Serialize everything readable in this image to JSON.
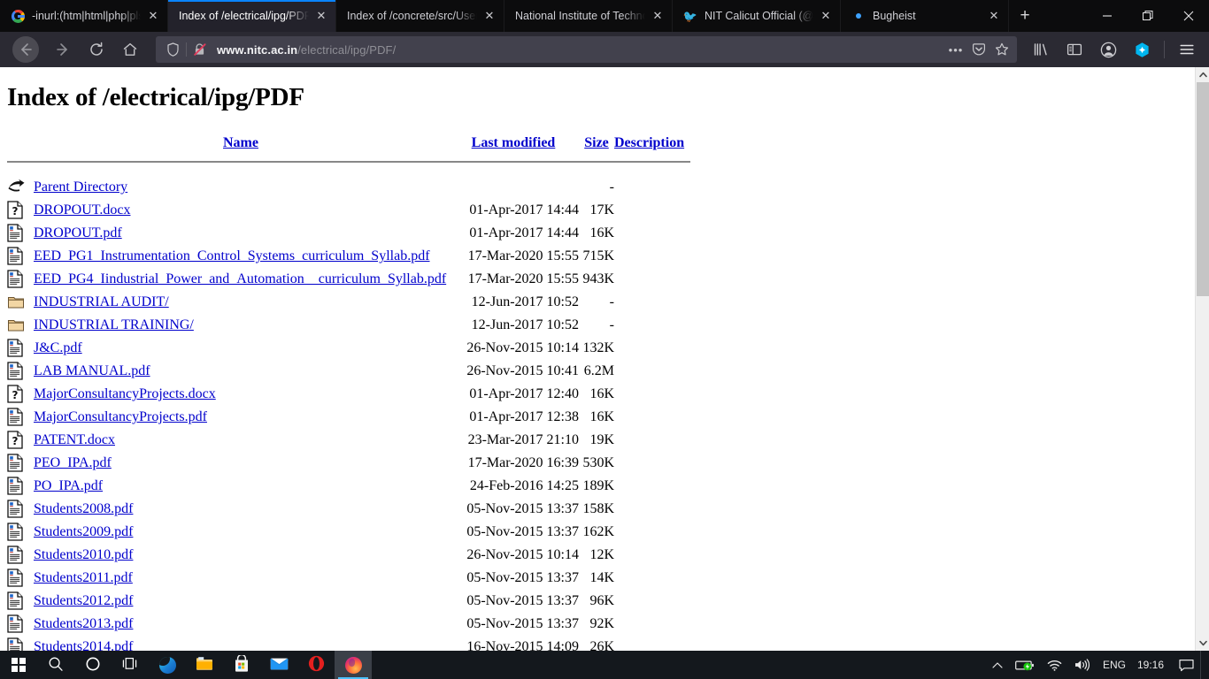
{
  "window": {
    "controls": {
      "minimize": "minimize",
      "restore": "restore",
      "close": "close"
    }
  },
  "tabs": [
    {
      "title": "-inurl:(htm|html|php|pls|t",
      "favicon": "google-icon",
      "active": false,
      "close_label": "✕"
    },
    {
      "title": "Index of /electrical/ipg/PDF",
      "favicon": "document-icon",
      "active": true,
      "close_label": "✕"
    },
    {
      "title": "Index of /concrete/src/User",
      "favicon": "document-icon",
      "active": false,
      "close_label": "✕"
    },
    {
      "title": "National Institute of Technolo",
      "favicon": "document-icon",
      "active": false,
      "close_label": "✕"
    },
    {
      "title": "NIT Calicut Official (@nit",
      "favicon": "twitter-icon",
      "active": false,
      "close_label": "✕"
    },
    {
      "title": "Bugheist",
      "favicon": "dot-icon",
      "active": false,
      "close_label": "✕"
    }
  ],
  "newtab_label": "+",
  "navbar": {
    "back": "back-icon",
    "forward": "forward-icon",
    "reload": "reload-icon",
    "home": "home-icon",
    "shield": "shield-icon",
    "insecure": "insecure-lock-icon",
    "url_domain": "www.nitc.ac.in",
    "url_path": "/electrical/ipg/PDF/",
    "url_full": "www.nitc.ac.in/electrical/ipg/PDF/",
    "more": "•••",
    "pocket": "pocket-icon",
    "bookmark": "star-icon",
    "library": "library-icon",
    "sidebar": "sidebar-icon",
    "account": "account-icon",
    "extension": "extension-icon",
    "menu": "hamburger-menu-icon"
  },
  "page": {
    "title": "Index of /electrical/ipg/PDF",
    "columns": {
      "name": "Name",
      "last_modified": "Last modified",
      "size": "Size",
      "description": "Description"
    },
    "rows": [
      {
        "icon": "parent-directory-icon",
        "name": "Parent Directory",
        "modified": "",
        "size": "-",
        "description": ""
      },
      {
        "icon": "unknown-file-icon",
        "name": "DROPOUT.docx",
        "modified": "01-Apr-2017 14:44",
        "size": "17K",
        "description": ""
      },
      {
        "icon": "text-file-icon",
        "name": "DROPOUT.pdf",
        "modified": "01-Apr-2017 14:44",
        "size": "16K",
        "description": ""
      },
      {
        "icon": "text-file-icon",
        "name": "EED_PG1_Instrumentation_Control_Systems_curriculum_Syllab.pdf",
        "modified": "17-Mar-2020 15:55",
        "size": "715K",
        "description": ""
      },
      {
        "icon": "text-file-icon",
        "name": "EED_PG4_Iindustrial_Power_and_Automation__curriculum_Syllab.pdf",
        "modified": "17-Mar-2020 15:55",
        "size": "943K",
        "description": ""
      },
      {
        "icon": "folder-icon",
        "name": "INDUSTRIAL AUDIT/",
        "modified": "12-Jun-2017 10:52",
        "size": "-",
        "description": ""
      },
      {
        "icon": "folder-icon",
        "name": "INDUSTRIAL TRAINING/",
        "modified": "12-Jun-2017 10:52",
        "size": "-",
        "description": ""
      },
      {
        "icon": "text-file-icon",
        "name": "J&C.pdf",
        "modified": "26-Nov-2015 10:14",
        "size": "132K",
        "description": ""
      },
      {
        "icon": "text-file-icon",
        "name": "LAB MANUAL.pdf",
        "modified": "26-Nov-2015 10:41",
        "size": "6.2M",
        "description": ""
      },
      {
        "icon": "unknown-file-icon",
        "name": "MajorConsultancyProjects.docx",
        "modified": "01-Apr-2017 12:40",
        "size": "16K",
        "description": ""
      },
      {
        "icon": "text-file-icon",
        "name": "MajorConsultancyProjects.pdf",
        "modified": "01-Apr-2017 12:38",
        "size": "16K",
        "description": ""
      },
      {
        "icon": "unknown-file-icon",
        "name": "PATENT.docx",
        "modified": "23-Mar-2017 21:10",
        "size": "19K",
        "description": ""
      },
      {
        "icon": "text-file-icon",
        "name": "PEO_IPA.pdf",
        "modified": "17-Mar-2020 16:39",
        "size": "530K",
        "description": ""
      },
      {
        "icon": "text-file-icon",
        "name": "PO_IPA.pdf",
        "modified": "24-Feb-2016 14:25",
        "size": "189K",
        "description": ""
      },
      {
        "icon": "text-file-icon",
        "name": "Students2008.pdf",
        "modified": "05-Nov-2015 13:37",
        "size": "158K",
        "description": ""
      },
      {
        "icon": "text-file-icon",
        "name": "Students2009.pdf",
        "modified": "05-Nov-2015 13:37",
        "size": "162K",
        "description": ""
      },
      {
        "icon": "text-file-icon",
        "name": "Students2010.pdf",
        "modified": "26-Nov-2015 10:14",
        "size": "12K",
        "description": ""
      },
      {
        "icon": "text-file-icon",
        "name": "Students2011.pdf",
        "modified": "05-Nov-2015 13:37",
        "size": "14K",
        "description": ""
      },
      {
        "icon": "text-file-icon",
        "name": "Students2012.pdf",
        "modified": "05-Nov-2015 13:37",
        "size": "96K",
        "description": ""
      },
      {
        "icon": "text-file-icon",
        "name": "Students2013.pdf",
        "modified": "05-Nov-2015 13:37",
        "size": "92K",
        "description": ""
      },
      {
        "icon": "text-file-icon",
        "name": "Students2014.pdf",
        "modified": "16-Nov-2015 14:09",
        "size": "26K",
        "description": ""
      }
    ]
  },
  "taskbar": {
    "items": [
      {
        "icon": "windows-start-icon",
        "name": "start-button",
        "active": false
      },
      {
        "icon": "search-icon",
        "name": "search-button",
        "active": false
      },
      {
        "icon": "cortana-icon",
        "name": "cortana-button",
        "active": false
      },
      {
        "icon": "task-view-icon",
        "name": "task-view-button",
        "active": false
      },
      {
        "icon": "edge-icon",
        "name": "edge-button",
        "active": false
      },
      {
        "icon": "file-explorer-icon",
        "name": "file-explorer-button",
        "active": false
      },
      {
        "icon": "microsoft-store-icon",
        "name": "microsoft-store-button",
        "active": false
      },
      {
        "icon": "mail-icon",
        "name": "mail-button",
        "active": false
      },
      {
        "icon": "opera-icon",
        "name": "opera-button",
        "active": false
      },
      {
        "icon": "firefox-icon",
        "name": "firefox-button",
        "active": true
      }
    ],
    "tray": {
      "chevron": "show-hidden-icons-icon",
      "battery": "battery-icon",
      "network": "wifi-icon",
      "volume": "volume-icon",
      "language": "ENG",
      "clock": "19:16",
      "notifications": "action-center-icon"
    }
  },
  "colors": {
    "link": "#0000cc",
    "accent": "#0a84ff",
    "chrome_bg": "#2b2a33",
    "tabstrip_bg": "#0c0c0d",
    "taskbar_bg": "#14181d",
    "folder": "#e8c48a"
  }
}
